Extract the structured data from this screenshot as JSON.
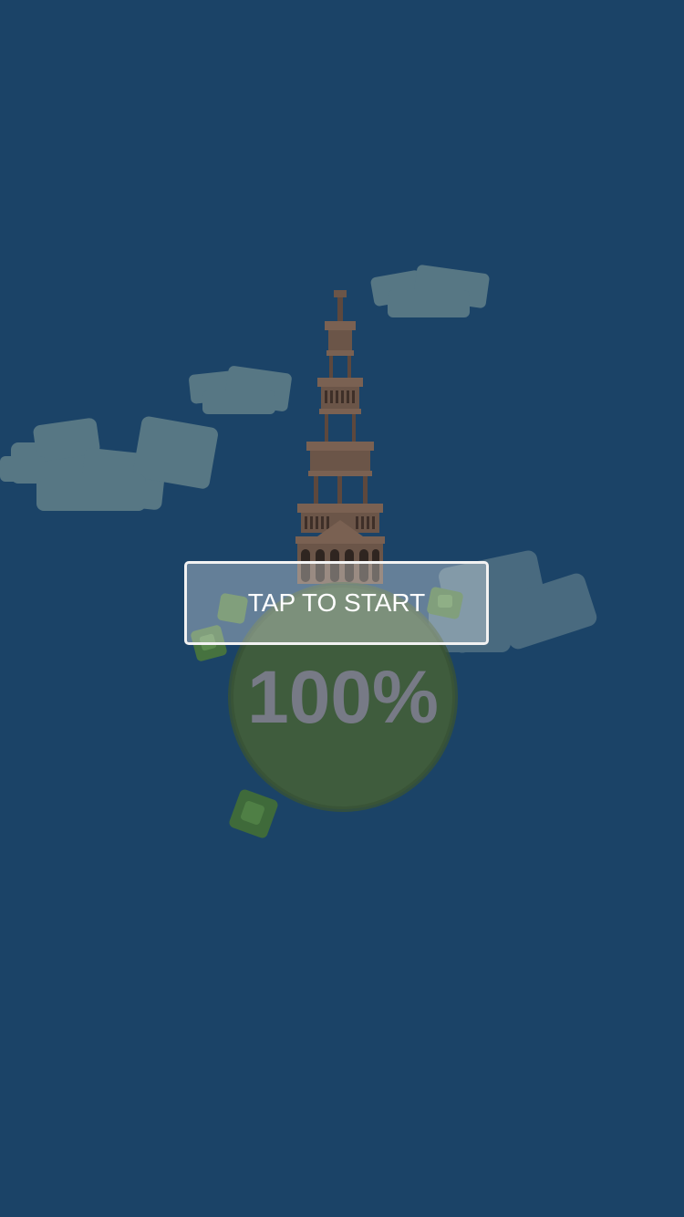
{
  "game": {
    "start_button_label": "TAP TO START",
    "progress_text": "100%"
  },
  "colors": {
    "background": "#1b4367",
    "planet": "#3f5c3d",
    "tower": "#6b5548",
    "cloud": "#5b7a86",
    "button_border": "#f2f2f2",
    "progress_text": "#777a86"
  },
  "icons": [
    "cloud-icon",
    "tower-icon",
    "planet-icon",
    "bush-icon"
  ]
}
